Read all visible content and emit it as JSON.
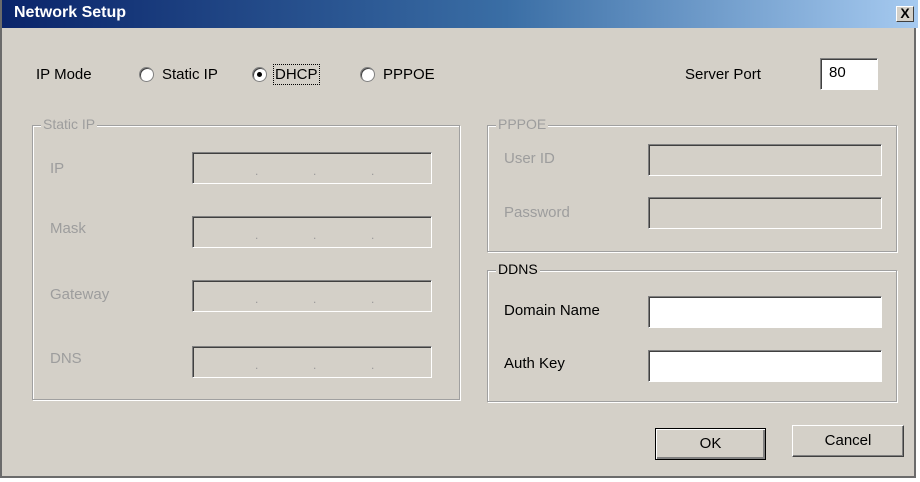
{
  "window": {
    "title": "Network Setup",
    "close_label": "X"
  },
  "ip_mode": {
    "label": "IP Mode",
    "options": [
      {
        "label": "Static IP",
        "selected": false
      },
      {
        "label": "DHCP",
        "selected": true
      },
      {
        "label": "PPPOE",
        "selected": false
      }
    ]
  },
  "server_port": {
    "label": "Server Port",
    "value": "80"
  },
  "static_ip": {
    "legend": "Static IP",
    "fields": [
      {
        "label": "IP"
      },
      {
        "label": "Mask"
      },
      {
        "label": "Gateway"
      },
      {
        "label": "DNS"
      }
    ],
    "separator": "."
  },
  "pppoe": {
    "legend": "PPPOE",
    "user_id_label": "User ID",
    "password_label": "Password"
  },
  "ddns": {
    "legend": "DDNS",
    "domain_name_label": "Domain Name",
    "auth_key_label": "Auth Key"
  },
  "buttons": {
    "ok": "OK",
    "cancel": "Cancel"
  }
}
